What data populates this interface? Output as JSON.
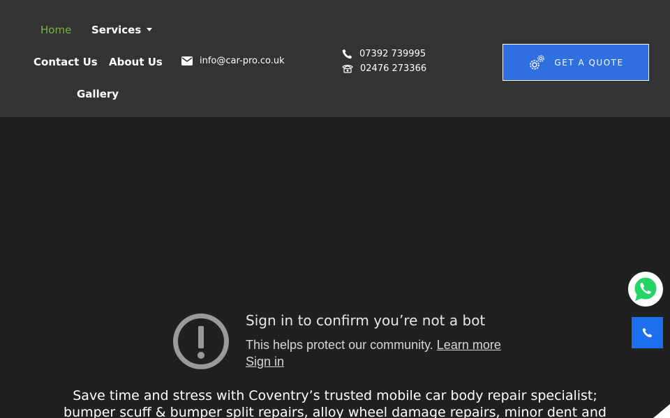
{
  "nav": {
    "home": "Home",
    "services": "Services",
    "contact": "Contact Us",
    "about": "About Us",
    "gallery": "Gallery"
  },
  "contact": {
    "email": "info@car-pro.co.uk",
    "mobile": "07392 739995",
    "landline": "02476 273366"
  },
  "quote_button": "GET A QUOTE",
  "notice": {
    "title": "Sign in to confirm you’re not a bot",
    "text": "This helps protect our community.",
    "learn_more": "Learn more",
    "sign_in": "Sign in"
  },
  "intro": {
    "line1": "Save time and stress with Coventry’s trusted mobile car body repair specialist;",
    "line2": "bumper scuff & bumper split repairs, alloy wheel damage repairs, minor dent and"
  },
  "colors": {
    "header_bg": "#333333",
    "page_bg": "#202020",
    "active_nav": "#7cb342",
    "accent_blue": "#2f6fe0",
    "whatsapp_green": "#25d366"
  }
}
